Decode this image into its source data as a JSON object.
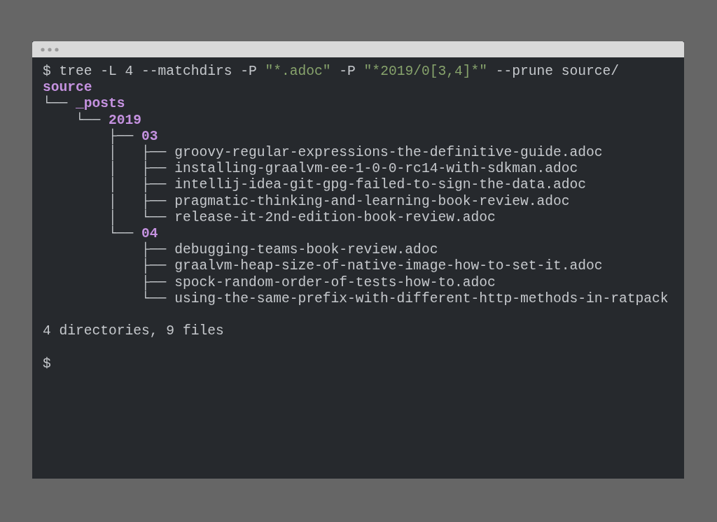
{
  "terminal": {
    "lines": [
      {
        "kind": "text",
        "spans": [
          {
            "text": "$ tree -L 4 --matchdirs -P ",
            "kind": "plain"
          },
          {
            "text": "\"*.adoc\"",
            "kind": "string"
          },
          {
            "text": " -P ",
            "kind": "plain"
          },
          {
            "text": "\"*2019/0[3,4]*\"",
            "kind": "string"
          },
          {
            "text": " --prune source/",
            "kind": "plain"
          }
        ]
      },
      {
        "kind": "text",
        "spans": [
          {
            "text": "source",
            "kind": "dir"
          }
        ]
      },
      {
        "kind": "text",
        "spans": [
          {
            "text": "└── ",
            "kind": "plain"
          },
          {
            "text": "_posts",
            "kind": "dir"
          }
        ]
      },
      {
        "kind": "text",
        "spans": [
          {
            "text": "    └── ",
            "kind": "plain"
          },
          {
            "text": "2019",
            "kind": "dir"
          }
        ]
      },
      {
        "kind": "text",
        "spans": [
          {
            "text": "        ├── ",
            "kind": "plain"
          },
          {
            "text": "03",
            "kind": "dir"
          }
        ]
      },
      {
        "kind": "text",
        "spans": [
          {
            "text": "        │   ├── groovy-regular-expressions-the-definitive-guide.adoc",
            "kind": "plain"
          }
        ]
      },
      {
        "kind": "text",
        "spans": [
          {
            "text": "        │   ├── installing-graalvm-ee-1-0-0-rc14-with-sdkman.adoc",
            "kind": "plain"
          }
        ]
      },
      {
        "kind": "text",
        "spans": [
          {
            "text": "        │   ├── intellij-idea-git-gpg-failed-to-sign-the-data.adoc",
            "kind": "plain"
          }
        ]
      },
      {
        "kind": "text",
        "spans": [
          {
            "text": "        │   ├── pragmatic-thinking-and-learning-book-review.adoc",
            "kind": "plain"
          }
        ]
      },
      {
        "kind": "text",
        "spans": [
          {
            "text": "        │   └── release-it-2nd-edition-book-review.adoc",
            "kind": "plain"
          }
        ]
      },
      {
        "kind": "text",
        "spans": [
          {
            "text": "        └── ",
            "kind": "plain"
          },
          {
            "text": "04",
            "kind": "dir"
          }
        ]
      },
      {
        "kind": "text",
        "spans": [
          {
            "text": "            ├── debugging-teams-book-review.adoc",
            "kind": "plain"
          }
        ]
      },
      {
        "kind": "text",
        "spans": [
          {
            "text": "            ├── graalvm-heap-size-of-native-image-how-to-set-it.adoc",
            "kind": "plain"
          }
        ]
      },
      {
        "kind": "text",
        "spans": [
          {
            "text": "            ├── spock-random-order-of-tests-how-to.adoc",
            "kind": "plain"
          }
        ]
      },
      {
        "kind": "text",
        "spans": [
          {
            "text": "            └── using-the-same-prefix-with-different-http-methods-in-ratpack",
            "kind": "plain"
          }
        ]
      },
      {
        "kind": "blank"
      },
      {
        "kind": "text",
        "spans": [
          {
            "text": "4 directories, 9 files",
            "kind": "plain"
          }
        ]
      },
      {
        "kind": "blank"
      },
      {
        "kind": "text",
        "spans": [
          {
            "text": "$",
            "kind": "plain"
          }
        ]
      }
    ]
  }
}
